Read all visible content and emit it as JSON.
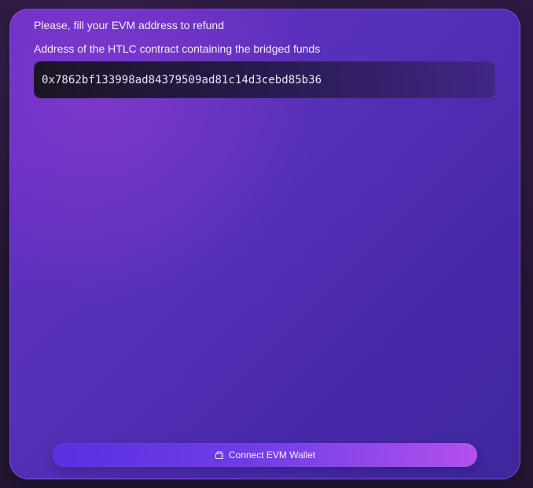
{
  "panel": {
    "title": "Please, fill your EVM address to refund",
    "field_label": "Address of the HTLC contract containing the bridged funds",
    "address_value": "0x7862bf133998ad84379509ad81c14d3cebd85b36"
  },
  "actions": {
    "connect_label": "Connect EVM Wallet",
    "icon": "wallet-icon"
  },
  "colors": {
    "background": "#241733",
    "panel_start": "#6a2fc4",
    "panel_end": "#3f279d",
    "input_bg": "#121216",
    "button_start": "#5a2fe1",
    "button_end": "#b350ef",
    "text": "#f1ebff"
  }
}
